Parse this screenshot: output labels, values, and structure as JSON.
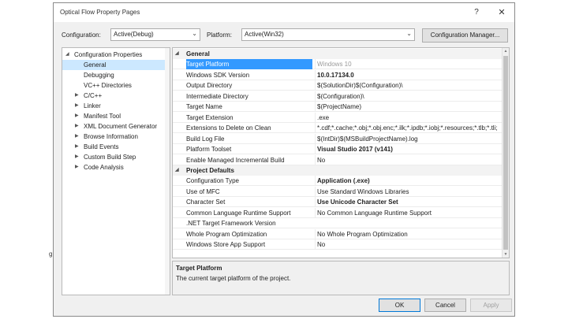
{
  "background": {
    "fragment_text": "g"
  },
  "window": {
    "title": "Optical Flow Property Pages",
    "help_label": "?",
    "close_label": "✕"
  },
  "config_bar": {
    "configuration_label": "Configuration:",
    "configuration_value": "Active(Debug)",
    "platform_label": "Platform:",
    "platform_value": "Active(Win32)",
    "manager_button": "Configuration Manager..."
  },
  "tree": {
    "root": "Configuration Properties",
    "items": [
      {
        "label": "General",
        "selected": true,
        "expander": ""
      },
      {
        "label": "Debugging",
        "expander": ""
      },
      {
        "label": "VC++ Directories",
        "expander": ""
      },
      {
        "label": "C/C++",
        "expander": "▶"
      },
      {
        "label": "Linker",
        "expander": "▶"
      },
      {
        "label": "Manifest Tool",
        "expander": "▶"
      },
      {
        "label": "XML Document Generator",
        "expander": "▶"
      },
      {
        "label": "Browse Information",
        "expander": "▶"
      },
      {
        "label": "Build Events",
        "expander": "▶"
      },
      {
        "label": "Custom Build Step",
        "expander": "▶"
      },
      {
        "label": "Code Analysis",
        "expander": "▶"
      }
    ]
  },
  "grid": {
    "sections": [
      {
        "title": "General",
        "rows": [
          {
            "name": "Target Platform",
            "value": "Windows 10",
            "selected": true
          },
          {
            "name": "Windows SDK Version",
            "value": "10.0.17134.0",
            "bold": true
          },
          {
            "name": "Output Directory",
            "value": "$(SolutionDir)$(Configuration)\\"
          },
          {
            "name": "Intermediate Directory",
            "value": "$(Configuration)\\"
          },
          {
            "name": "Target Name",
            "value": "$(ProjectName)"
          },
          {
            "name": "Target Extension",
            "value": ".exe"
          },
          {
            "name": "Extensions to Delete on Clean",
            "value": "*.cdf;*.cache;*.obj;*.obj.enc;*.ilk;*.ipdb;*.iobj;*.resources;*.tlb;*.tli;"
          },
          {
            "name": "Build Log File",
            "value": "$(IntDir)$(MSBuildProjectName).log"
          },
          {
            "name": "Platform Toolset",
            "value": "Visual Studio 2017 (v141)",
            "bold": true
          },
          {
            "name": "Enable Managed Incremental Build",
            "value": "No"
          }
        ]
      },
      {
        "title": "Project Defaults",
        "rows": [
          {
            "name": "Configuration Type",
            "value": "Application (.exe)",
            "bold": true
          },
          {
            "name": "Use of MFC",
            "value": "Use Standard Windows Libraries"
          },
          {
            "name": "Character Set",
            "value": "Use Unicode Character Set",
            "bold": true
          },
          {
            "name": "Common Language Runtime Support",
            "value": "No Common Language Runtime Support"
          },
          {
            "name": ".NET Target Framework Version",
            "value": ""
          },
          {
            "name": "Whole Program Optimization",
            "value": "No Whole Program Optimization"
          },
          {
            "name": "Windows Store App Support",
            "value": "No"
          }
        ]
      }
    ]
  },
  "description": {
    "title": "Target Platform",
    "text": "The current target platform of the project."
  },
  "buttons": {
    "ok": "OK",
    "cancel": "Cancel",
    "apply": "Apply"
  },
  "colors": {
    "selection": "#3399ff",
    "tree_selection": "#cce8ff",
    "ok_border": "#0078d7"
  }
}
